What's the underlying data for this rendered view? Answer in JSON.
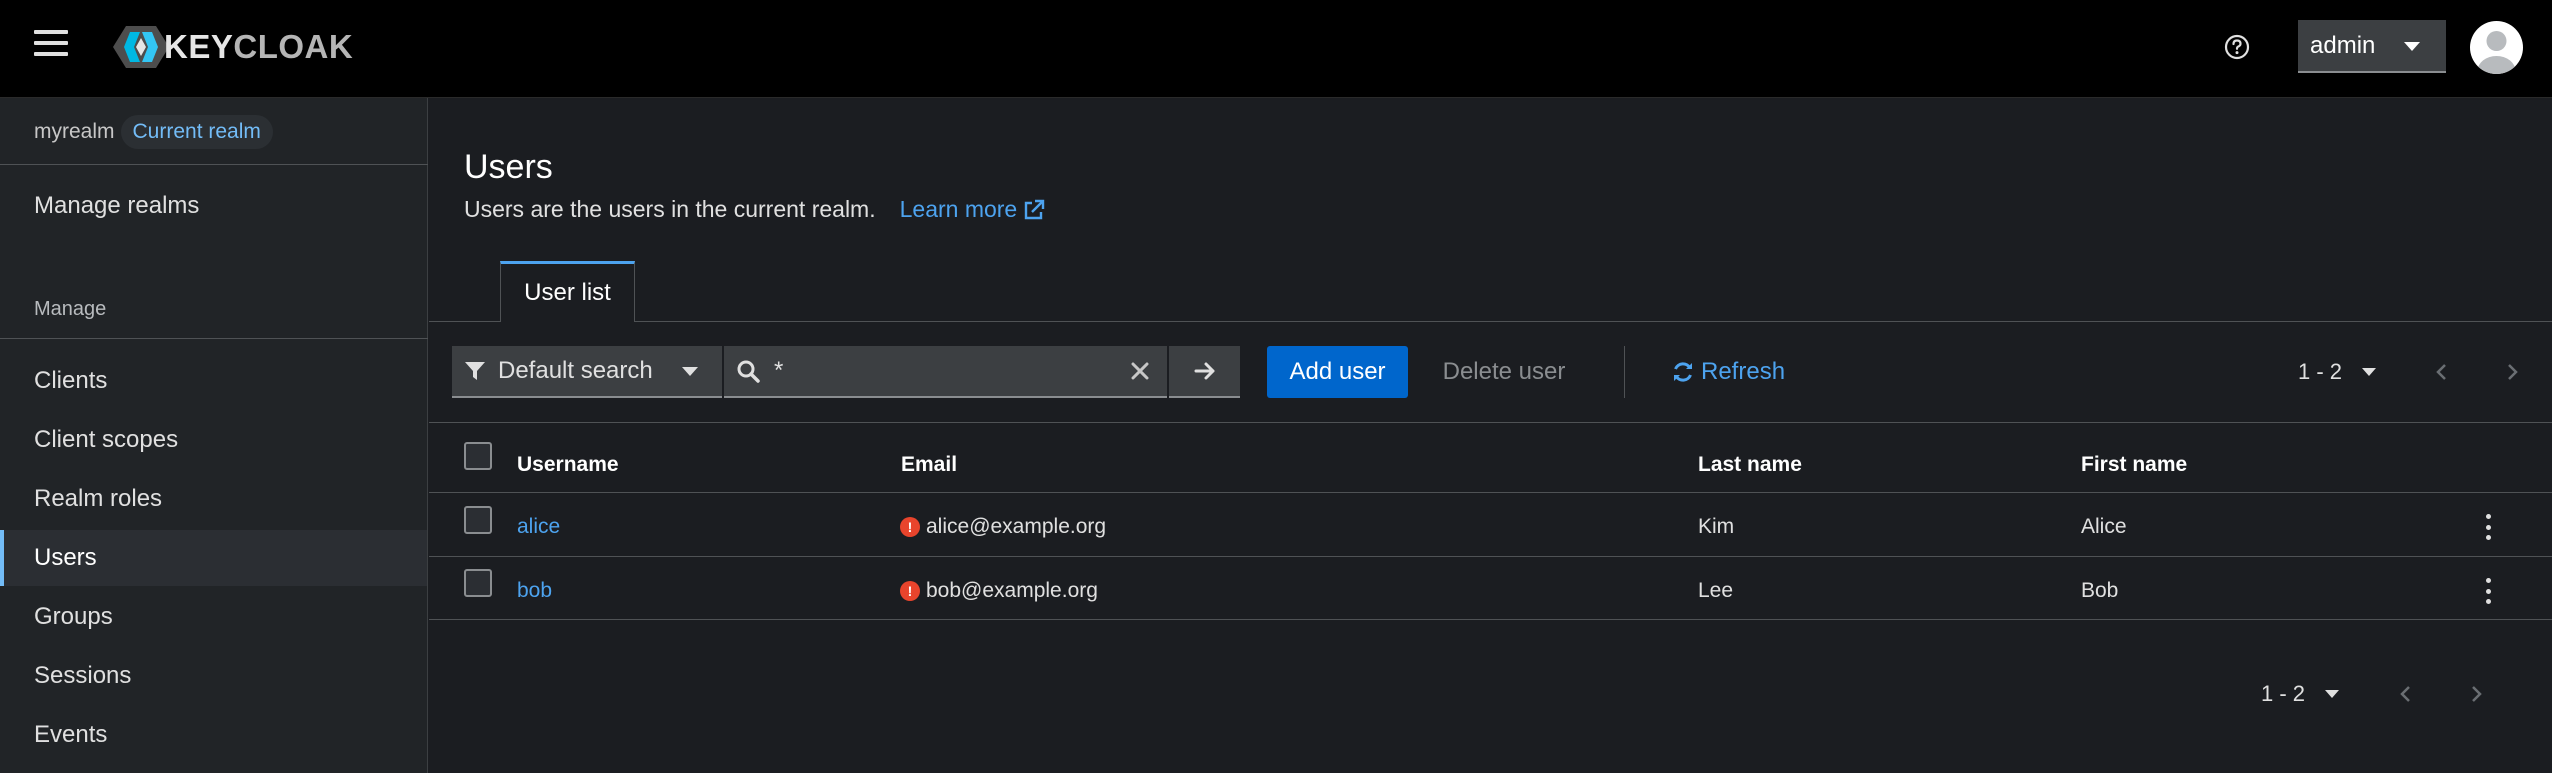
{
  "header": {
    "logo_text_a": "KEY",
    "logo_text_b": "CLOAK",
    "user_menu": "admin"
  },
  "sidebar": {
    "realm_name": "myrealm",
    "realm_badge": "Current realm",
    "manage_realms": "Manage realms",
    "section_label": "Manage",
    "items": [
      {
        "label": "Clients"
      },
      {
        "label": "Client scopes"
      },
      {
        "label": "Realm roles"
      },
      {
        "label": "Users"
      },
      {
        "label": "Groups"
      },
      {
        "label": "Sessions"
      },
      {
        "label": "Events"
      }
    ]
  },
  "main": {
    "title": "Users",
    "description": "Users are the users in the current realm.",
    "learn_more": "Learn more",
    "tab": "User list",
    "toolbar": {
      "filter_label": "Default search",
      "search_value": "*",
      "add_user": "Add user",
      "delete_user": "Delete user",
      "refresh": "Refresh",
      "pagination": "1 - 2"
    },
    "table": {
      "headers": {
        "username": "Username",
        "email": "Email",
        "last_name": "Last name",
        "first_name": "First name"
      },
      "rows": [
        {
          "username": "alice",
          "email": "alice@example.org",
          "last_name": "Kim",
          "first_name": "Alice"
        },
        {
          "username": "bob",
          "email": "bob@example.org",
          "last_name": "Lee",
          "first_name": "Bob"
        }
      ]
    },
    "bottom_pagination": "1 - 2"
  },
  "colors": {
    "accent": "#0066cc",
    "link": "#4da3ef",
    "warning": "#e8442c"
  }
}
